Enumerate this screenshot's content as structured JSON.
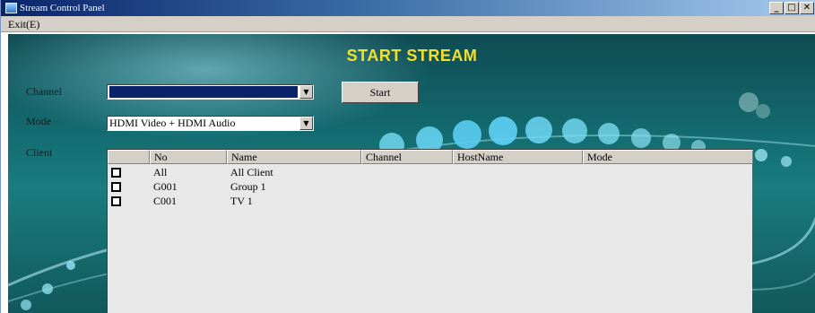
{
  "window": {
    "title": "Stream Control Panel",
    "icon": "app-icon"
  },
  "menu": {
    "exit": "Exit(E)"
  },
  "heading": "START STREAM",
  "form": {
    "channel_label": "Channel",
    "channel_value": "",
    "mode_label": "Mode",
    "mode_value": "HDMI Video + HDMI Audio",
    "client_label": "Client",
    "start_button": "Start"
  },
  "table": {
    "columns": [
      "",
      "No",
      "Name",
      "Channel",
      "HostName",
      "Mode"
    ],
    "rows": [
      {
        "checked": false,
        "no": "All",
        "name": "All Client",
        "channel": "",
        "hostname": "",
        "mode": ""
      },
      {
        "checked": false,
        "no": "G001",
        "name": "Group 1",
        "channel": "",
        "hostname": "",
        "mode": ""
      },
      {
        "checked": false,
        "no": "C001",
        "name": "TV 1",
        "channel": "",
        "hostname": "",
        "mode": ""
      }
    ]
  },
  "colors": {
    "title_bar": "#0a246a",
    "heading_text": "#f2e12a",
    "background_teal": "#136b70",
    "selection": "#0a246a"
  }
}
